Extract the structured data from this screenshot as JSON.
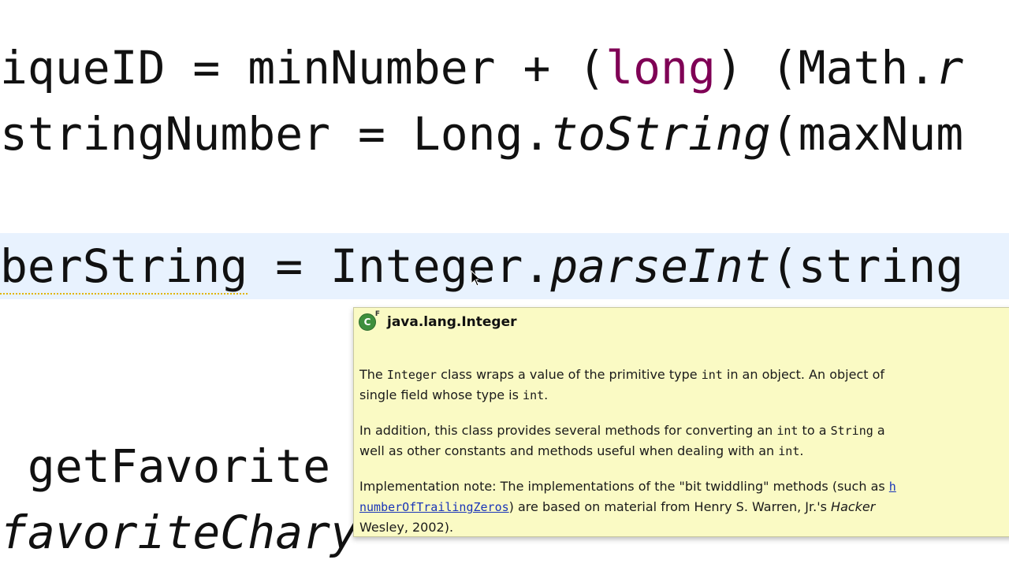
{
  "editor": {
    "line1": {
      "part1": "iqueID = minNumber + (",
      "keyword": "long",
      "part2": ") (Math.",
      "tail": "r"
    },
    "line2": {
      "part1": "stringNumber = Long.",
      "method": "toString",
      "part2": "(maxNum"
    },
    "line3": {
      "ident": "berString",
      "part1": " = Integer.",
      "method": "parseInt",
      "part2": "(string"
    },
    "line4": {
      "text": " getFavorite"
    },
    "line5": {
      "text": "favoriteChar",
      "tail": "y"
    }
  },
  "javadoc": {
    "icon": "class-final-icon",
    "icon_letter": "C",
    "icon_final_mark": "F",
    "title": "java.lang.Integer",
    "p1": {
      "t1": "The ",
      "c1": "Integer",
      "t2": " class wraps a value of the primitive type ",
      "c2": "int",
      "t3": " in an object. An object of",
      "line2_t1": "single field whose type is ",
      "line2_c1": "int",
      "line2_t2": "."
    },
    "p2": {
      "t1": "In addition, this class provides several methods for converting an ",
      "c1": "int",
      "t2": " to a ",
      "c2": "String",
      "t3": " a",
      "line2_t1": "well as other constants and methods useful when dealing with an ",
      "line2_c1": "int",
      "line2_t2": "."
    },
    "p3": {
      "t1": "Implementation note: The implementations of the \"bit twiddling\" methods (such as ",
      "link1": "h",
      "link2": "numberOfTrailingZeros",
      "t2": ") are based on material from Henry S. Warren, Jr.'s ",
      "book": "Hacker",
      "line3": "Wesley, 2002)."
    }
  },
  "colors": {
    "keyword": "#7f0055",
    "current_line": "#e8f2fe",
    "popup_bg": "#fafac4",
    "link": "#1a35b8",
    "warning_underline": "#e0b400"
  }
}
